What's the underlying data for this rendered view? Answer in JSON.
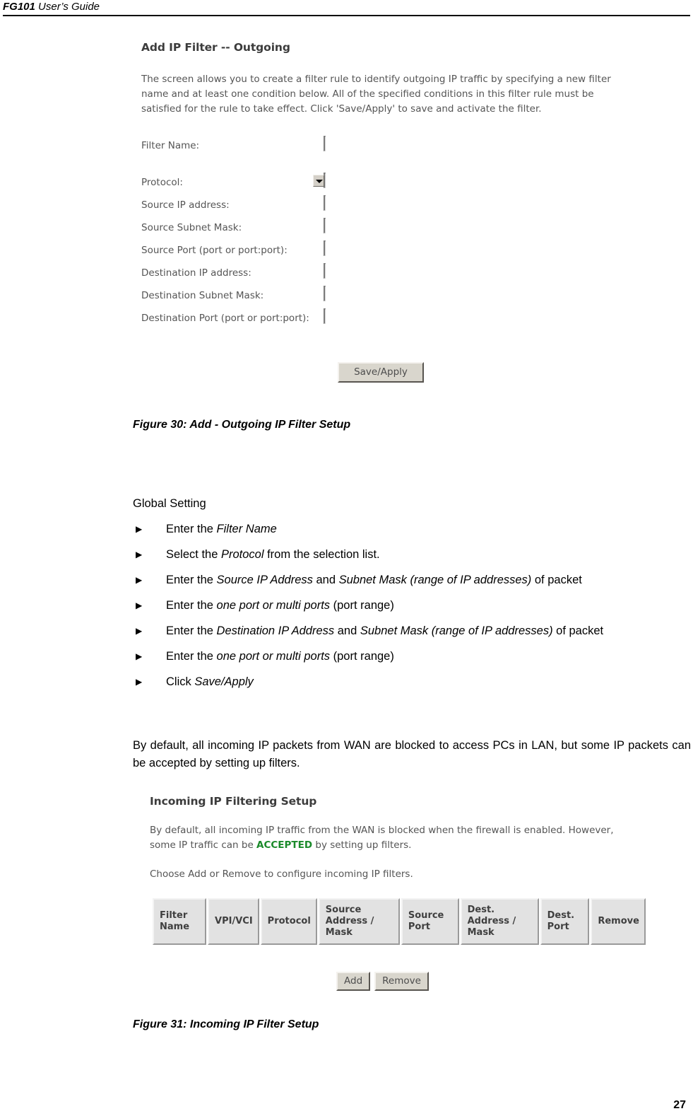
{
  "header": {
    "model": "FG101",
    "guide": " User’s Guide"
  },
  "screenshot_outgoing": {
    "title": "Add IP Filter -- Outgoing",
    "description": "The screen allows you to create a filter rule to identify outgoing IP traffic by specifying a new filter name and at least one condition below. All of the specified conditions in this filter rule must be satisfied for the rule to take effect. Click 'Save/Apply' to save and activate the filter.",
    "fields": [
      {
        "label": "Filter Name:",
        "value": "",
        "type": "text"
      },
      {
        "label": "Protocol:",
        "value": "",
        "type": "select"
      },
      {
        "label": "Source IP address:",
        "value": "",
        "type": "text"
      },
      {
        "label": "Source Subnet Mask:",
        "value": "",
        "type": "text"
      },
      {
        "label": "Source Port (port or port:port):",
        "value": "",
        "type": "text"
      },
      {
        "label": "Destination IP address:",
        "value": "",
        "type": "text"
      },
      {
        "label": "Destination Subnet Mask:",
        "value": "",
        "type": "text"
      },
      {
        "label": "Destination Port (port or port:port):",
        "value": "",
        "type": "text"
      }
    ],
    "save_button": "Save/Apply"
  },
  "caption_30": "Figure 30: Add - Outgoing IP Filter Setup",
  "instructions": {
    "heading": "Global Setting",
    "items": [
      {
        "pre": "Enter the ",
        "em": "Filter Name",
        "post": ""
      },
      {
        "pre": "Select the ",
        "em": "Protocol",
        "post": " from the selection list."
      },
      {
        "pre": "Enter the ",
        "em": "Source IP Address",
        "mid": " and ",
        "em2": "Subnet Mask (range of IP addresses)",
        "post": " of packet"
      },
      {
        "pre": "Enter the ",
        "em": "one port or multi ports",
        "post": " (port range)"
      },
      {
        "pre": "Enter the ",
        "em": "Destination IP Address",
        "mid": " and ",
        "em2": "Subnet Mask (range of IP addresses)",
        "post": " of packet"
      },
      {
        "pre": "Enter the ",
        "em": "one port or multi ports",
        "post": " (port range)"
      },
      {
        "pre": "Click ",
        "em": "Save/Apply",
        "post": ""
      }
    ]
  },
  "paragraph_incoming": "By default, all incoming IP packets from WAN are blocked to access PCs in LAN, but some IP packets can be accepted by setting up filters.",
  "screenshot_incoming": {
    "title": "Incoming IP Filtering Setup",
    "paragraph_1_before": "By default, all incoming IP traffic from the WAN is blocked when the firewall is enabled. However, some IP traffic can be ",
    "paragraph_1_accepted": "ACCEPTED",
    "paragraph_1_after": " by setting up filters.",
    "paragraph_2": "Choose Add or Remove to configure incoming IP filters.",
    "table": {
      "columns": [
        "Filter Name",
        "VPI/VCI",
        "Protocol",
        "Source Address / Mask",
        "Source Port",
        "Dest. Address / Mask",
        "Dest. Port",
        "Remove"
      ],
      "rows": []
    },
    "buttons": {
      "add": "Add",
      "remove": "Remove"
    },
    "accent_green": "#1a8a2a"
  },
  "caption_31": "Figure 31: Incoming IP Filter Setup",
  "page_number": "27"
}
